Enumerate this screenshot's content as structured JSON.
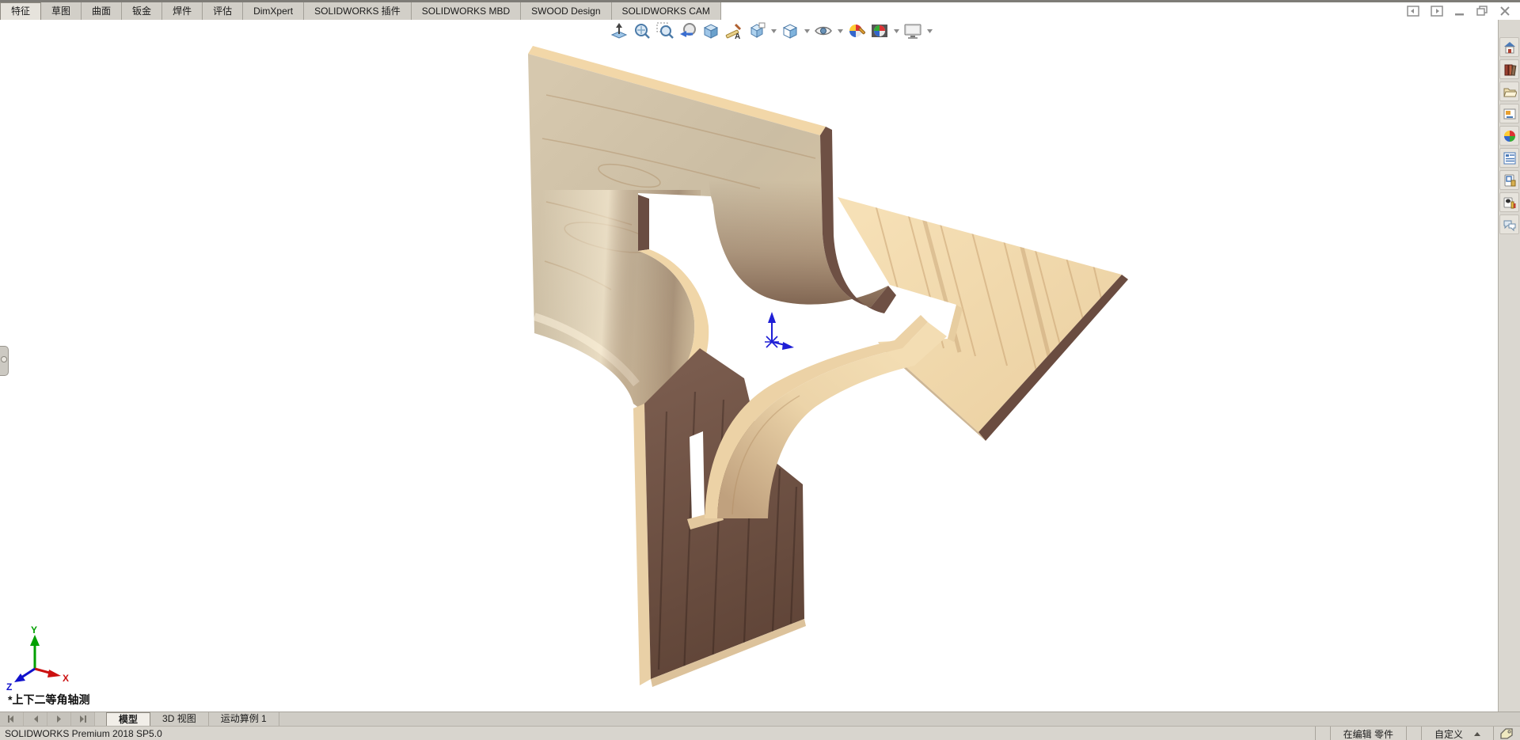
{
  "window": {
    "app": "SOLIDWORKS",
    "controls": [
      "pane-collapse-left",
      "pane-collapse-right",
      "minimize",
      "restore",
      "close"
    ]
  },
  "command_tabs": {
    "active": "特征",
    "items": [
      "特征",
      "草图",
      "曲面",
      "钣金",
      "焊件",
      "评估",
      "DimXpert",
      "SOLIDWORKS 插件",
      "SOLIDWORKS MBD",
      "SWOOD Design",
      "SOLIDWORKS CAM"
    ]
  },
  "heads_up_toolbar": {
    "tools": [
      "normal-to",
      "zoom-to-fit",
      "zoom-to-area",
      "previous-view",
      "section-view",
      "dynamic-annotation-views",
      "view-orientation",
      "display-style",
      "hide-show-items",
      "edit-appearance",
      "apply-scene",
      "view-settings"
    ],
    "tools_with_dropdown": [
      "view-orientation",
      "display-style",
      "hide-show-items",
      "apply-scene",
      "view-settings"
    ]
  },
  "task_pane": {
    "tabs": [
      "solidworks-resources",
      "design-library",
      "file-explorer",
      "view-palette",
      "appearances-scenes-decals",
      "custom-properties",
      "swood-library",
      "swood-options",
      "solidworks-forum"
    ]
  },
  "viewport": {
    "view_label": "*上下二等角轴测",
    "triad": {
      "x_label": "X",
      "y_label": "Y",
      "z_label": "Z"
    }
  },
  "sheet_tabs": {
    "active": "模型",
    "items": [
      "模型",
      "3D 视图",
      "运动算例 1"
    ]
  },
  "status_bar": {
    "product": "SOLIDWORKS Premium 2018 SP5.0",
    "mode": "在编辑 零件",
    "customize": "自定义"
  },
  "colors": {
    "maple_face": "#cfc0a6",
    "pine_top": "#f3dbb0",
    "edge_tan": "#f0d6a8",
    "walnut_dark": "#6b4e43",
    "origin_blue": "#1f1fd6",
    "triad_x_red": "#cc1111",
    "triad_y_green": "#00a000",
    "triad_z_blue": "#1111cc",
    "ui_gray": "#d2cfc8"
  }
}
